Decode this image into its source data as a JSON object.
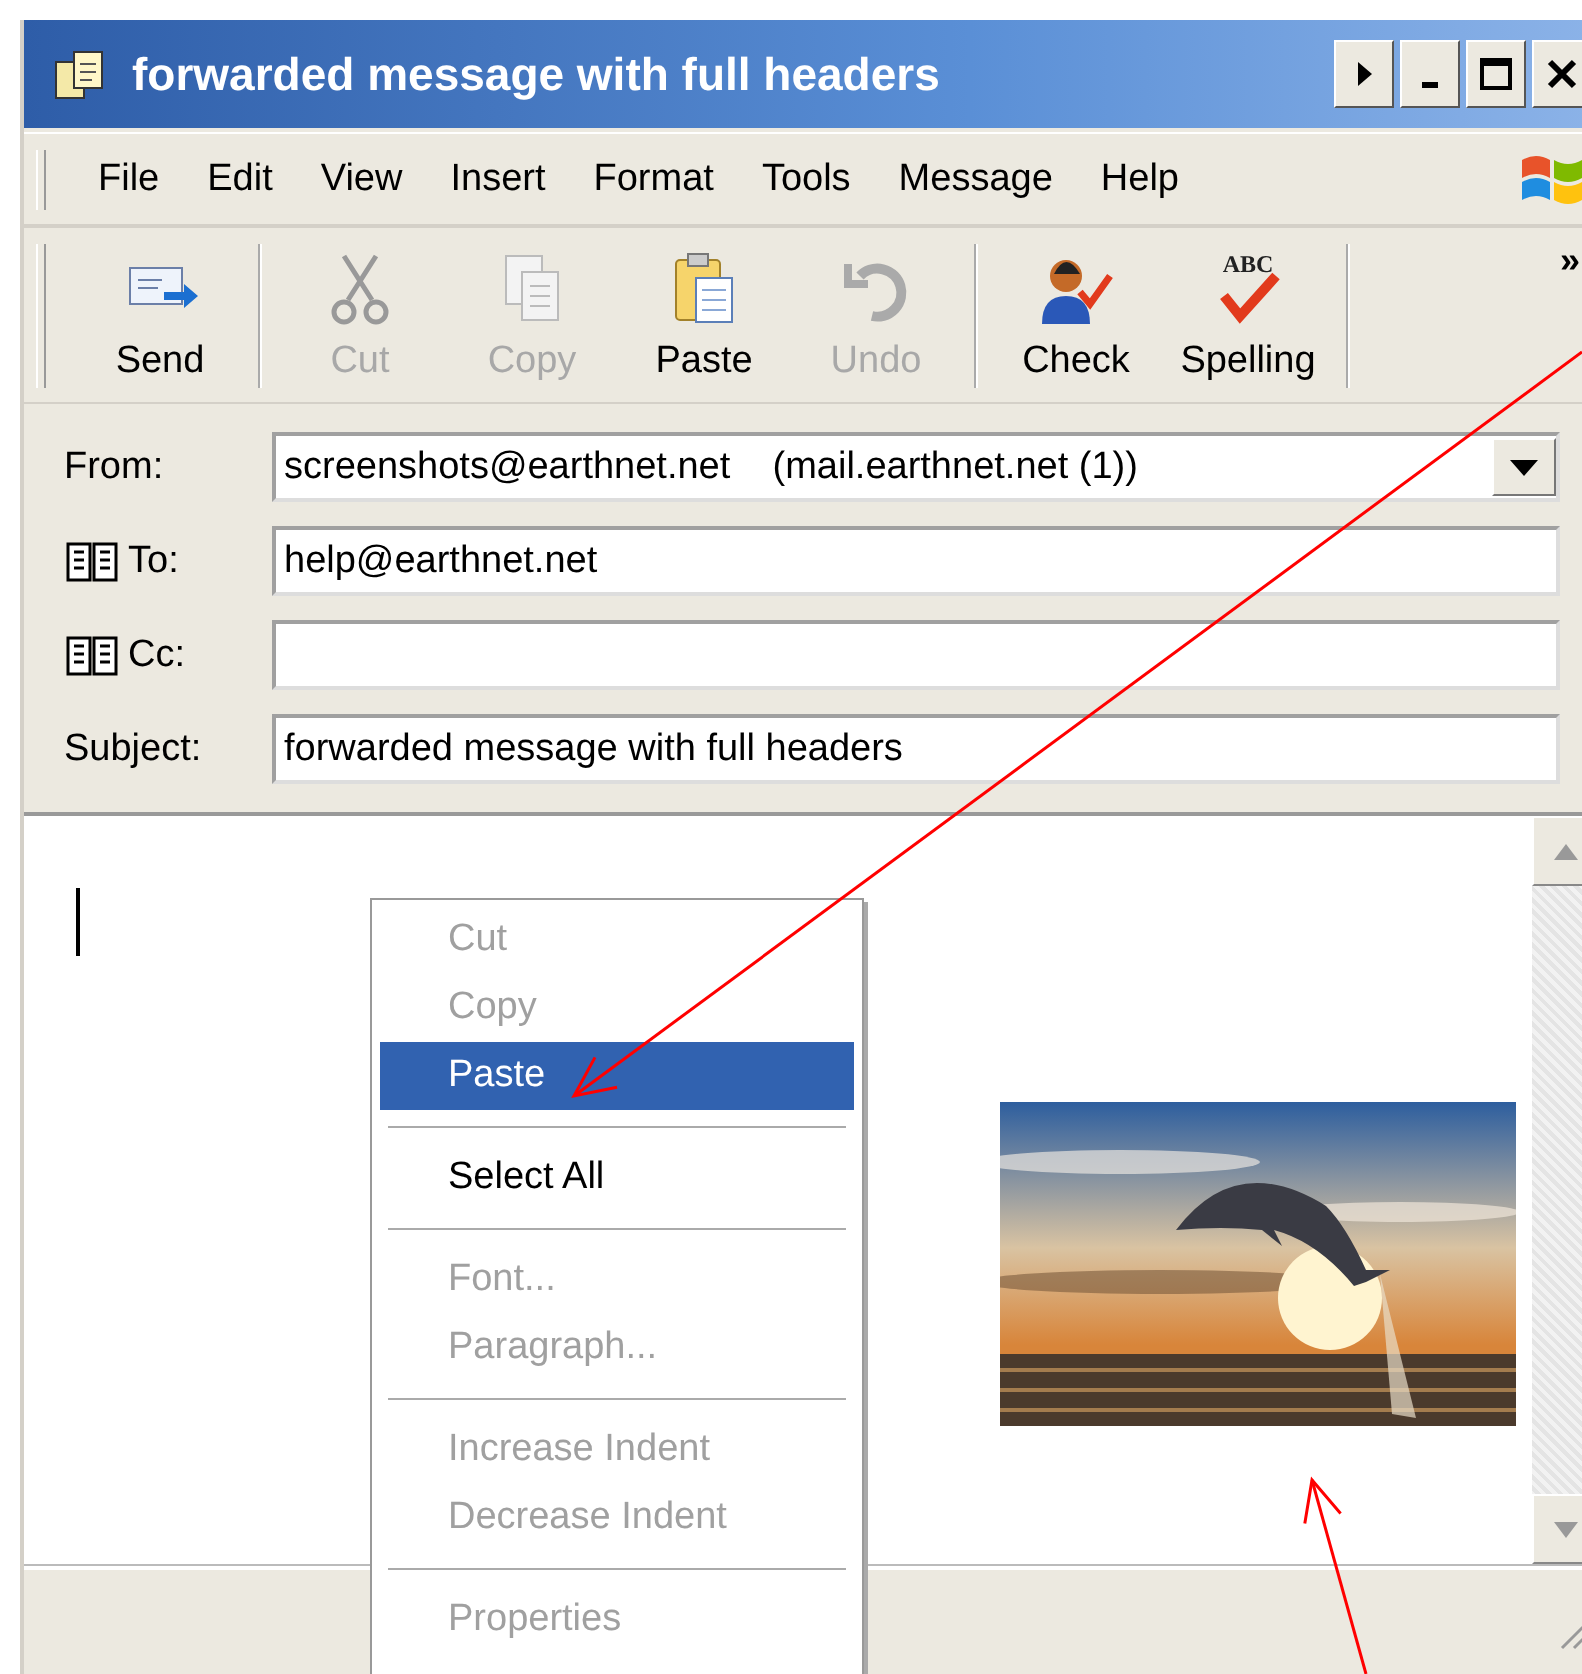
{
  "window": {
    "title": "forwarded message with full headers"
  },
  "menu": [
    "File",
    "Edit",
    "View",
    "Insert",
    "Format",
    "Tools",
    "Message",
    "Help"
  ],
  "toolbar": {
    "buttons": [
      {
        "kind": "send",
        "label": "Send",
        "disabled": false
      },
      {
        "kind": "cut",
        "label": "Cut",
        "disabled": true
      },
      {
        "kind": "copy",
        "label": "Copy",
        "disabled": true
      },
      {
        "kind": "paste",
        "label": "Paste",
        "disabled": false
      },
      {
        "kind": "undo",
        "label": "Undo",
        "disabled": true
      },
      {
        "kind": "check",
        "label": "Check",
        "disabled": false
      },
      {
        "kind": "spelling",
        "label": "Spelling",
        "disabled": false,
        "badge": "ABC"
      }
    ],
    "overflow": "»"
  },
  "fields": [
    {
      "kind": "dropdown",
      "label": "From:",
      "value": "screenshots@earthnet.net    (mail.earthnet.net (1))"
    },
    {
      "kind": "address",
      "label": "To:",
      "value": "help@earthnet.net"
    },
    {
      "kind": "address",
      "label": "Cc:"
    },
    {
      "kind": "text",
      "label": "Subject:",
      "value": "forwarded message with full headers"
    }
  ],
  "body": {
    "attachment": {
      "kind": "picture"
    }
  },
  "context_menu": [
    [
      {
        "label": "Cut",
        "disabled": true,
        "selected": false
      },
      {
        "label": "Copy",
        "disabled": true,
        "selected": false
      },
      {
        "label": "Paste",
        "disabled": false,
        "selected": true
      }
    ],
    [
      {
        "label": "Select All",
        "disabled": false,
        "selected": false
      }
    ],
    [
      {
        "label": "Font...",
        "disabled": true,
        "selected": false
      },
      {
        "label": "Paragraph...",
        "disabled": true,
        "selected": false
      }
    ],
    [
      {
        "label": "Increase Indent",
        "disabled": true,
        "selected": false
      },
      {
        "label": "Decrease Indent",
        "disabled": true,
        "selected": false
      }
    ],
    [
      {
        "label": "Properties",
        "disabled": true,
        "selected": false
      }
    ]
  ]
}
